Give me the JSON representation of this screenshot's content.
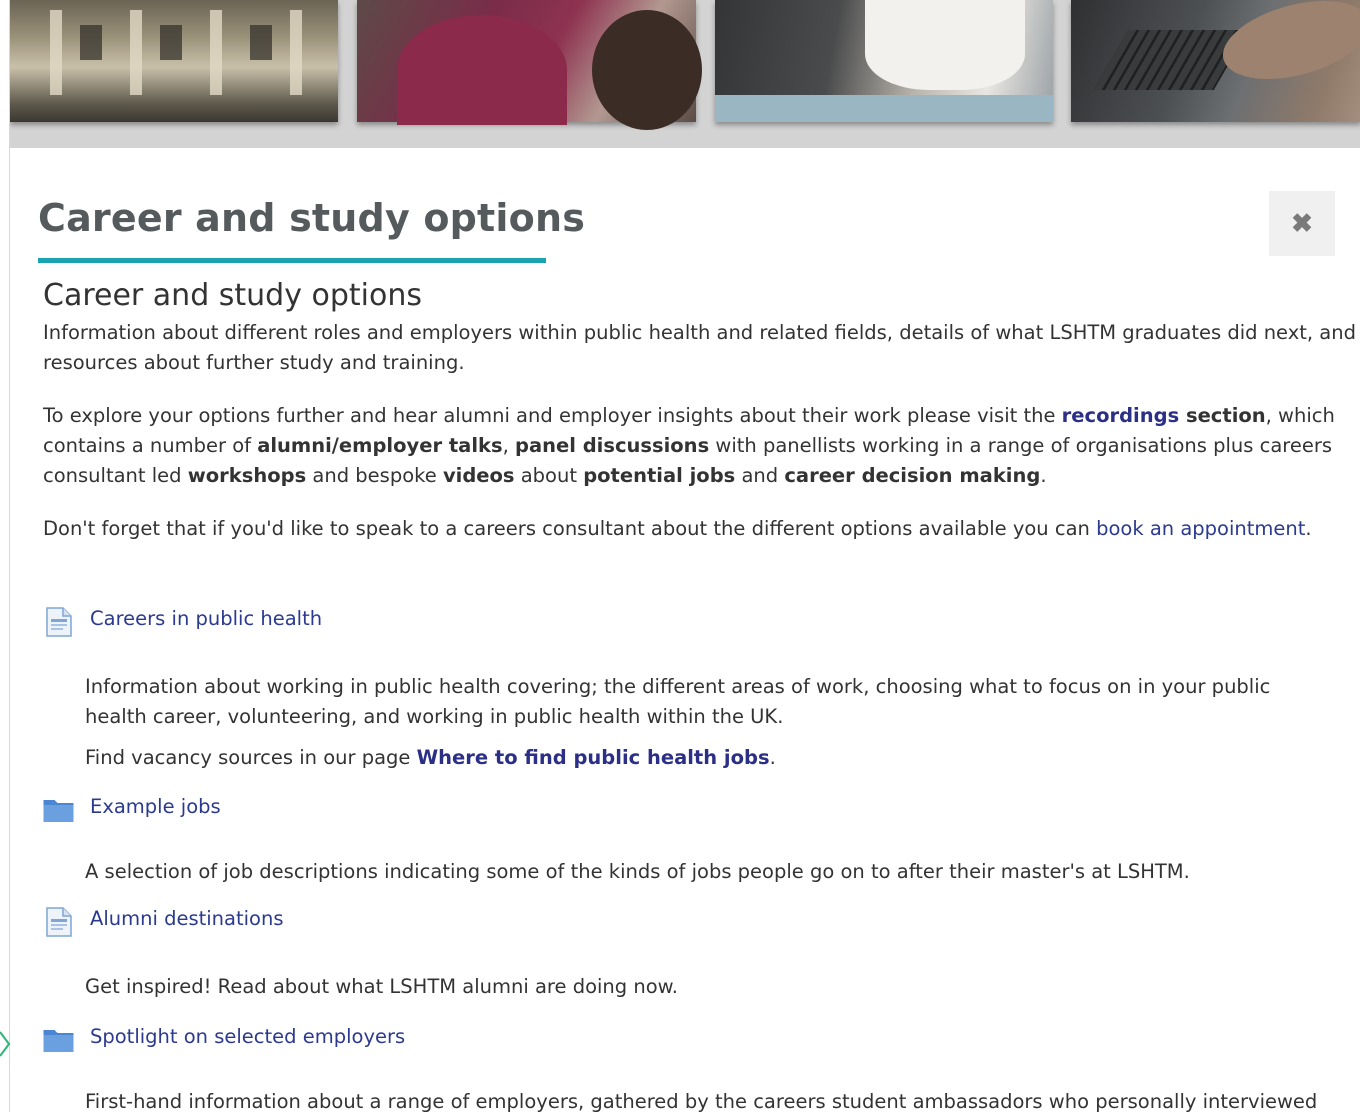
{
  "header": {
    "title": "Career and study options",
    "close_label": "✖"
  },
  "intro": {
    "subtitle": "Career and study options",
    "p1": "Information about different roles and employers within public health and related fields, details of what LSHTM graduates did next, and resources about further study and training.",
    "p2": {
      "t1": "To explore your options further and hear alumni and employer insights about their work please visit the ",
      "recordings": "recordings",
      "section": " section",
      "t2": ", which contains a number of ",
      "alumni_talks": "alumni/employer talks",
      "t3": ", ",
      "panel": "panel discussions",
      "t4": " with panellists working in a range of organisations plus careers consultant led ",
      "workshops": "workshops",
      "t5": " and bespoke ",
      "videos": "videos",
      "t6": " about ",
      "potential_jobs": "potential jobs",
      "t7": " and ",
      "decision": "career decision making",
      "t8": "."
    },
    "p3": {
      "text": "Don't forget that if you'd like to speak to a careers consultant about the different options available you can ",
      "link": "book an appointment",
      "end": "."
    }
  },
  "items": [
    {
      "type": "page",
      "icon": "page-icon",
      "label": "Careers in public health",
      "desc": "Information about working in public health covering; the different areas of work, choosing what to focus on in your public health career, volunteering, and working in public health within the UK.",
      "extra_text": "Find vacancy sources in our page ",
      "extra_link": "Where to find public health jobs",
      "extra_end": "."
    },
    {
      "type": "folder",
      "icon": "folder-icon",
      "label": "Example jobs",
      "desc": "A selection of job descriptions indicating some of the kinds of jobs people go on to after their master's at LSHTM."
    },
    {
      "type": "page",
      "icon": "page-icon",
      "label": "Alumni destinations",
      "desc": "Get inspired! Read about what LSHTM alumni are doing now."
    },
    {
      "type": "folder",
      "icon": "folder-icon",
      "label": "Spotlight on selected employers",
      "desc": "First-hand information about a range of employers, gathered by the careers student ambassadors who personally interviewed"
    }
  ],
  "colors": {
    "accent": "#1aa3b0",
    "link": "#2b3a8f",
    "folder": "#5b93d6"
  }
}
